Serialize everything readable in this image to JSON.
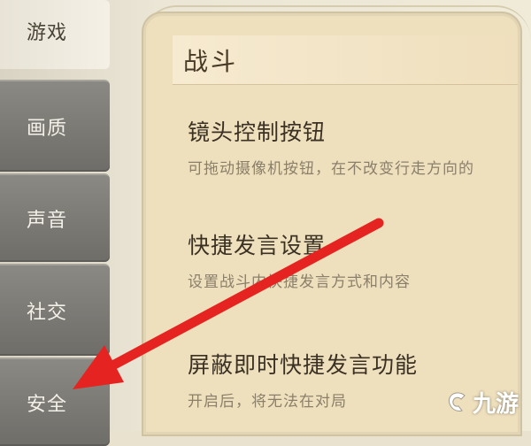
{
  "sidebar": {
    "tabs": [
      {
        "label": "游戏"
      },
      {
        "label": "画质"
      },
      {
        "label": "声音"
      },
      {
        "label": "社交"
      },
      {
        "label": "安全"
      }
    ]
  },
  "panel": {
    "section_title": "战斗",
    "settings": [
      {
        "name": "镜头控制按钮",
        "desc": "可拖动摄像机按钮，在不改变行走方向的"
      },
      {
        "name": "快捷发言设置",
        "desc": "设置战斗内快捷发言方式和内容"
      },
      {
        "name": "屏蔽即时快捷发言功能",
        "desc": "开启后，将无法在对局"
      }
    ]
  },
  "annotation": {
    "arrow_color": "#e52421",
    "icon": "red-arrow-icon"
  },
  "watermark": {
    "text": "九游",
    "icon": "jiuyou-logo-icon"
  }
}
